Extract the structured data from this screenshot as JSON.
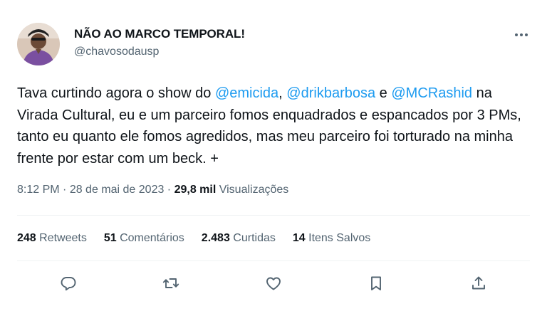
{
  "author": {
    "name": "NÃO AO MARCO TEMPORAL!",
    "handle": "@chavosodausp"
  },
  "tweet": {
    "text_parts": [
      "Tava curtindo agora o show do ",
      "@emicida",
      ", ",
      "@drikbarbosa",
      " e ",
      "@MCRashid",
      " na Virada Cultural, eu e um parceiro fomos enquadrados e espancados por 3 PMs, tanto eu quanto ele fomos agredidos, mas meu parceiro foi torturado na minha frente por estar com um beck. +"
    ],
    "mention_color": "#1d9bf0"
  },
  "meta": {
    "time": "8:12 PM",
    "sep1": " · ",
    "date": "28 de mai de 2023",
    "sep2": " · ",
    "views_count": "29,8 mil",
    "views_label": " Visualizações"
  },
  "stats": {
    "retweets_count": "248",
    "retweets_label": " Retweets",
    "comments_count": "51",
    "comments_label": " Comentários",
    "likes_count": "2.483",
    "likes_label": " Curtidas",
    "saves_count": "14",
    "saves_label": " Itens Salvos"
  },
  "actions": {
    "reply_icon": "reply-icon",
    "retweet_icon": "retweet-icon",
    "like_icon": "heart-icon",
    "bookmark_icon": "bookmark-icon",
    "share_icon": "share-icon",
    "icon_color": "#536471"
  },
  "more_icon": "more-icon"
}
